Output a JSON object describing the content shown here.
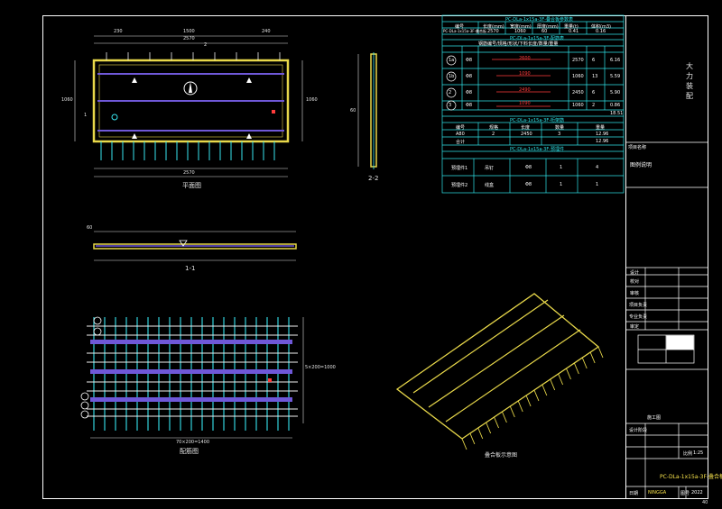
{
  "drawing": {
    "plan_view_label": "平面图",
    "section_1_label": "1-1",
    "section_2_label": "2-2",
    "rebar_plan_label": "配筋图",
    "isometric_label": "叠合板示意图",
    "dim_total_top": "2570",
    "dim_total_bottom": "2570",
    "dim_side_left": "1060",
    "dim_side_right": "1060",
    "dim_segment_a": "230",
    "dim_segment_b": "1500",
    "dim_segment_c": "240",
    "dim_height": "60",
    "dim_rebar_bottom": "70×200=1400",
    "dim_rebar_side": "5×200=1000",
    "dim_thickness": "60",
    "mark_1": "1",
    "mark_2": "2",
    "corner_text": "40"
  },
  "tables": {
    "t1_title": "PC-DLa-1x15a-3F-叠合板参数表",
    "t1_headers": [
      "编号",
      "长度(mm)",
      "宽度(mm)",
      "厚度(mm)",
      "重量(t)",
      "体积(m3)"
    ],
    "t1_row": [
      "PC-DLa-1x15a-3F-叠合板",
      "2570",
      "1060",
      "60",
      "0.41",
      "0.16"
    ],
    "t2_title": "PC-DLa-1x15a-3F-配筋表",
    "t2_subhead": "钢筋编号/规格/形状/下料长度/数量/重量",
    "t2_rows": [
      [
        "1a",
        "Φ8",
        "2600",
        "2570",
        "6",
        "6.16"
      ],
      [
        "1b",
        "Φ8",
        "1090",
        "1060",
        "13",
        "5.59"
      ],
      [
        "2",
        "Φ8",
        "2490",
        "2450",
        "6",
        "5.90"
      ],
      [
        "3",
        "Φ8",
        "1090",
        "1060",
        "2",
        "0.86"
      ]
    ],
    "t2_total": "18.51",
    "t3_title": "PC-DLa-1x15a-3F-桁架筋",
    "t3_headers": [
      "编号",
      "规格",
      "长度",
      "数量",
      "重量"
    ],
    "t3_rows": [
      [
        "A80",
        "2",
        "2450",
        "3",
        "12.96"
      ],
      [
        "合计",
        "",
        "",
        "",
        "12.96"
      ]
    ],
    "t4_title": "PC-DLa-1x15a-3F-预埋件",
    "t4_rows": [
      [
        "预埋件1",
        "吊钉",
        "Φ8",
        "1",
        "4"
      ],
      [
        "预埋件2",
        "线盒",
        "Φ8",
        "1",
        "1"
      ]
    ]
  },
  "title_block": {
    "company": "大力装配",
    "project_label": "项目名称",
    "remark": "图例说明",
    "rows": [
      "设计",
      "校对",
      "审核",
      "项目负责",
      "专业负责",
      "审定"
    ],
    "stage_label": "设计阶段",
    "scale_label": "比例",
    "scale_value": "1:25",
    "drawing_title": "PC-DLa-1x15a-3F-叠合板",
    "sheet_label": "图号",
    "sheet_value": "2022",
    "signature": "NINGGA",
    "date_label": "日期",
    "note": "施工图"
  },
  "colors": {
    "slab_outline": "#e8d84a",
    "rebar_cyan": "#38e6f0",
    "rebar_white": "#f2f2f2",
    "truss_purple": "#6f58d8",
    "table_cyan": "#2fe3e8",
    "frame_white": "#ffffff",
    "red_mark": "#ff3b3b"
  }
}
